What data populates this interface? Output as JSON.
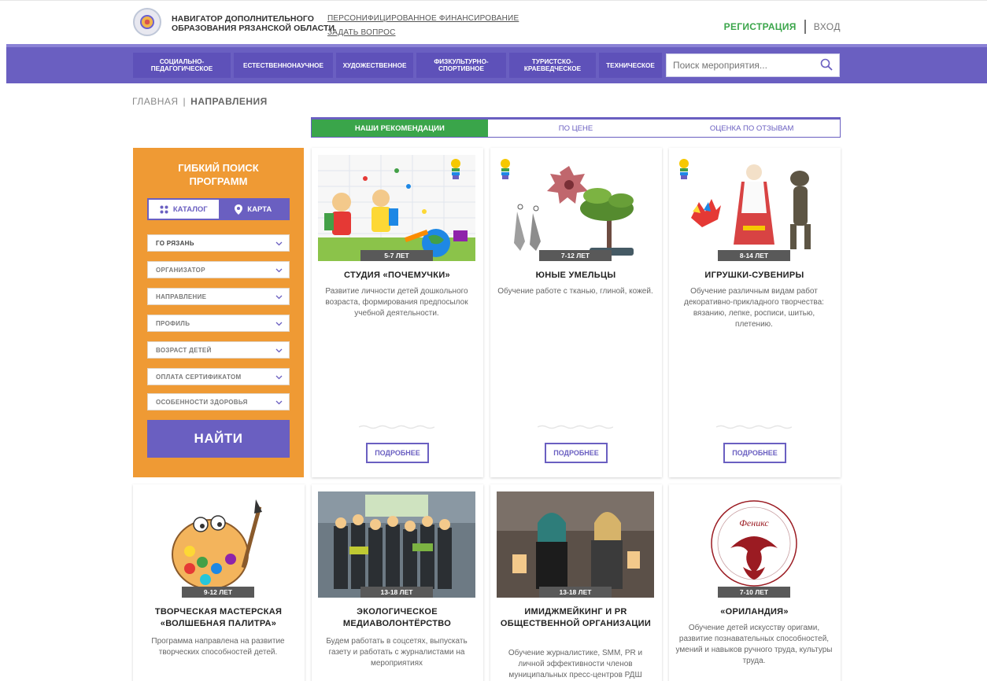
{
  "header": {
    "brand_line1": "НАВИГАТОР ДОПОЛНИТЕЛЬНОГО",
    "brand_line2": "ОБРАЗОВАНИЯ РЯЗАНСКОЙ ОБЛАСТИ",
    "link_financing": "ПЕРСОНИФИЦИРОВАННОЕ ФИНАНСИРОВАНИЕ",
    "link_question": "ЗАДАТЬ ВОПРОС",
    "register": "РЕГИСТРАЦИЯ",
    "login": "ВХОД"
  },
  "nav": {
    "items": [
      {
        "label": "СОЦИАЛЬНО-\nПЕДАГОГИЧЕСКОЕ"
      },
      {
        "label": "ЕСТЕСТВЕННОНАУЧНОЕ"
      },
      {
        "label": "ХУДОЖЕСТВЕННОЕ"
      },
      {
        "label": "ФИЗКУЛЬТУРНО-\nСПОРТИВНОЕ"
      },
      {
        "label": "ТУРИСТСКО-\nКРАЕВЕДЧЕСКОЕ"
      },
      {
        "label": "ТЕХНИЧЕСКОЕ"
      }
    ],
    "search_placeholder": "Поиск мероприятия..."
  },
  "breadcrumb": {
    "home": "ГЛАВНАЯ",
    "separator": "|",
    "current": "НАПРАВЛЕНИЯ"
  },
  "sort_tabs": [
    {
      "label": "НАШИ РЕКОМЕНДАЦИИ",
      "active": true
    },
    {
      "label": "ПО ЦЕНЕ",
      "active": false
    },
    {
      "label": "ОЦЕНКА ПО ОТЗЫВАМ",
      "active": false
    }
  ],
  "filter": {
    "title_line1": "ГИБКИЙ ПОИСК",
    "title_line2": "ПРОГРАММ",
    "catalog": "КАТАЛОГ",
    "map": "КАРТА",
    "selects": [
      "ГО РЯЗАНЬ",
      "ОРГАНИЗАТОР",
      "НАПРАВЛЕНИЕ",
      "ПРОФИЛЬ",
      "ВОЗРАСТ ДЕТЕЙ",
      "ОПЛАТА СЕРТИФИКАТОМ",
      "ОСОБЕННОСТИ ЗДОРОВЬЯ"
    ],
    "find_button": "НАЙТИ"
  },
  "cards": [
    {
      "age": "5-7 ЛЕТ",
      "title": "СТУДИЯ «ПОЧЕМУЧКИ»",
      "desc": "Развитие личности детей дошкольного возраста, формирования предпосылок учебной деятельности.",
      "more": "ПОДРОБНЕЕ"
    },
    {
      "age": "7-12 ЛЕТ",
      "title": "ЮНЫЕ УМЕЛЬЦЫ",
      "desc": "Обучение работе с тканью, глиной, кожей.",
      "more": "ПОДРОБНЕЕ"
    },
    {
      "age": "8-14 ЛЕТ",
      "title": "ИГРУШКИ-СУВЕНИРЫ",
      "desc": "Обучение различным видам работ декоративно-прикладного творчества: вязанию, лепке, росписи, шитью, плетению.",
      "more": "ПОДРОБНЕЕ"
    },
    {
      "age": "9-12 ЛЕТ",
      "title": "ТВОРЧЕСКАЯ МАСТЕРСКАЯ «ВОЛШЕБНАЯ ПАЛИТРА»",
      "desc": "Программа направлена на развитие творческих способностей детей."
    },
    {
      "age": "13-18 ЛЕТ",
      "title": "ЭКОЛОГИЧЕСКОЕ МЕДИАВОЛОНТЁРСТВО",
      "desc": "Будем работать в соцсетях, выпускать газету и работать с журналистами на мероприятиях"
    },
    {
      "age": "13-18 ЛЕТ",
      "title": "ИМИДЖМЕЙКИНГ И PR ОБЩЕСТВЕННОЙ ОРГАНИЗАЦИИ",
      "desc": "Обучение журналистике, SMM, PR и личной эффективности членов муниципальных пресс-центров РДШ"
    },
    {
      "age": "7-10 ЛЕТ",
      "title": "«ОРИЛАНДИЯ»",
      "desc": "Обучение детей искусству оригами, развитие познавательных способностей, умений и навыков ручного труда, культуры труда.",
      "logo_text": "Феникс"
    }
  ],
  "colors": {
    "purple": "#6a5fc1",
    "green": "#3aa54a",
    "orange": "#ef9a34",
    "age_badge": "#595959"
  }
}
